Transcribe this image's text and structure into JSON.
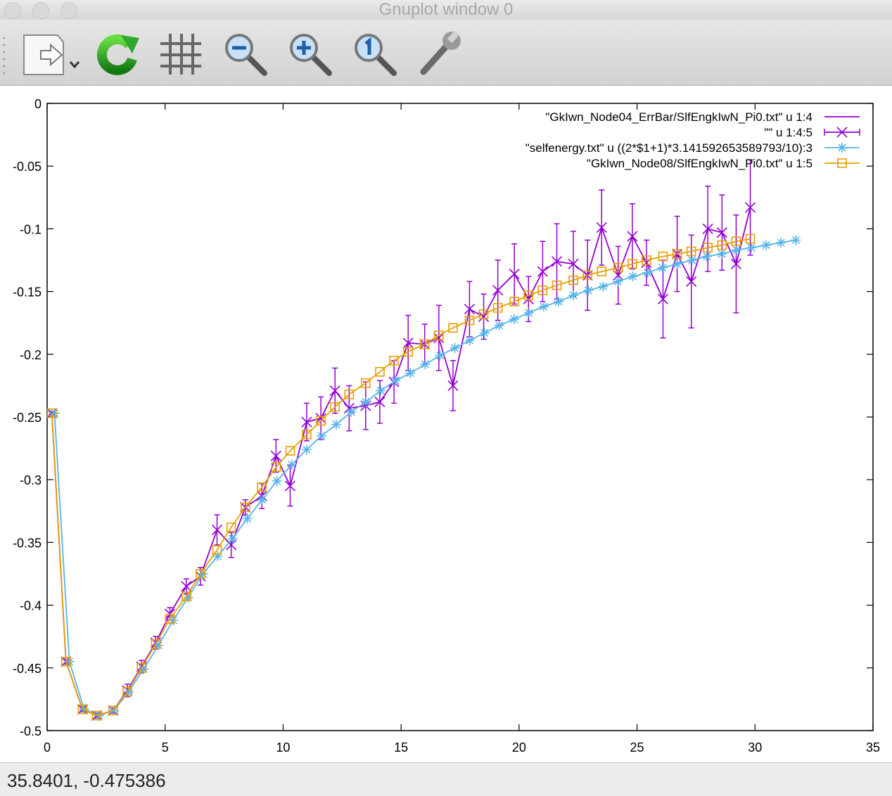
{
  "window": {
    "title": "Gnuplot window 0"
  },
  "toolbar": {
    "buttons": [
      {
        "name": "export-button",
        "icon": "export-document-icon"
      },
      {
        "name": "replot-button",
        "icon": "replot-icon"
      },
      {
        "name": "grid-button",
        "icon": "grid-icon"
      },
      {
        "name": "zoom-prev-button",
        "icon": "zoom-out-icon"
      },
      {
        "name": "zoom-next-button",
        "icon": "zoom-in-icon"
      },
      {
        "name": "unzoom-button",
        "icon": "zoom-reset-icon"
      },
      {
        "name": "settings-button",
        "icon": "wrench-icon"
      }
    ]
  },
  "status": {
    "coords": "35.8401, -0.475386"
  },
  "chart_data": {
    "type": "line",
    "xlim": [
      0,
      35
    ],
    "ylim": [
      -0.5,
      0
    ],
    "grid": false,
    "legend_position": "top-right",
    "xticks": [
      "0",
      "5",
      "10",
      "15",
      "20",
      "25",
      "30",
      "35"
    ],
    "yticks": [
      "0",
      "-0.05",
      "-0.1",
      "-0.15",
      "-0.2",
      "-0.25",
      "-0.3",
      "-0.35",
      "-0.4",
      "-0.45",
      "-0.5"
    ],
    "xtick_values": [
      0,
      5,
      10,
      15,
      20,
      25,
      30,
      35
    ],
    "ytick_values": [
      0,
      -0.05,
      -0.1,
      -0.15,
      -0.2,
      -0.25,
      -0.3,
      -0.35,
      -0.4,
      -0.45,
      -0.5
    ],
    "series": [
      {
        "name": "\"GkIwn_Node04_ErrBar/SlfEngkIwN_Pi0.txt\" u 1:4",
        "style": "line",
        "color": "#9400d3",
        "x": [
          0.2,
          0.8,
          1.5,
          2.1,
          2.8,
          3.4,
          4.0,
          4.6,
          5.2,
          5.9,
          6.5,
          7.2,
          7.8,
          8.4,
          9.1,
          9.7,
          10.3,
          11.0,
          11.6,
          12.2,
          12.8,
          13.5,
          14.1,
          14.7,
          15.3,
          16.0,
          16.6,
          17.2,
          17.9,
          18.5,
          19.1,
          19.8,
          20.4,
          21.0,
          21.6,
          22.3,
          22.9,
          23.5,
          24.2,
          24.8,
          25.4,
          26.1,
          26.7,
          27.3,
          28.0,
          28.6,
          29.2,
          29.8
        ],
        "y": [
          -0.247,
          -0.445,
          -0.483,
          -0.488,
          -0.484,
          -0.468,
          -0.449,
          -0.43,
          -0.407,
          -0.385,
          -0.377,
          -0.34,
          -0.352,
          -0.322,
          -0.313,
          -0.281,
          -0.305,
          -0.254,
          -0.251,
          -0.229,
          -0.243,
          -0.241,
          -0.238,
          -0.222,
          -0.191,
          -0.192,
          -0.187,
          -0.225,
          -0.164,
          -0.17,
          -0.149,
          -0.136,
          -0.156,
          -0.134,
          -0.126,
          -0.128,
          -0.137,
          -0.099,
          -0.137,
          -0.106,
          -0.127,
          -0.156,
          -0.12,
          -0.142,
          -0.1,
          -0.103,
          -0.128,
          -0.083
        ]
      },
      {
        "name": "\"\" u 1:4:5",
        "style": "errorbars",
        "color": "#9400d3",
        "x": [
          0.2,
          0.8,
          1.5,
          2.1,
          2.8,
          3.4,
          4.0,
          4.6,
          5.2,
          5.9,
          6.5,
          7.2,
          7.8,
          8.4,
          9.1,
          9.7,
          10.3,
          11.0,
          11.6,
          12.2,
          12.8,
          13.5,
          14.1,
          14.7,
          15.3,
          16.0,
          16.6,
          17.2,
          17.9,
          18.5,
          19.1,
          19.8,
          20.4,
          21.0,
          21.6,
          22.3,
          22.9,
          23.5,
          24.2,
          24.8,
          25.4,
          26.1,
          26.7,
          27.3,
          28.0,
          28.6,
          29.2,
          29.8
        ],
        "y": [
          -0.247,
          -0.445,
          -0.483,
          -0.488,
          -0.484,
          -0.468,
          -0.449,
          -0.43,
          -0.407,
          -0.385,
          -0.377,
          -0.34,
          -0.352,
          -0.322,
          -0.313,
          -0.281,
          -0.305,
          -0.254,
          -0.251,
          -0.229,
          -0.243,
          -0.241,
          -0.238,
          -0.222,
          -0.191,
          -0.192,
          -0.187,
          -0.225,
          -0.164,
          -0.17,
          -0.149,
          -0.136,
          -0.156,
          -0.134,
          -0.126,
          -0.128,
          -0.137,
          -0.099,
          -0.137,
          -0.106,
          -0.127,
          -0.156,
          -0.12,
          -0.142,
          -0.1,
          -0.103,
          -0.128,
          -0.083
        ],
        "err": [
          0.001,
          0.002,
          0.002,
          0.002,
          0.002,
          0.005,
          0.005,
          0.005,
          0.005,
          0.006,
          0.007,
          0.012,
          0.01,
          0.006,
          0.01,
          0.013,
          0.016,
          0.015,
          0.017,
          0.018,
          0.018,
          0.019,
          0.017,
          0.017,
          0.022,
          0.016,
          0.026,
          0.02,
          0.022,
          0.018,
          0.024,
          0.024,
          0.018,
          0.024,
          0.03,
          0.026,
          0.028,
          0.03,
          0.023,
          0.026,
          0.018,
          0.031,
          0.03,
          0.037,
          0.034,
          0.03,
          0.039,
          0.038
        ]
      },
      {
        "name": "\"selfenergy.txt\" u ((2*$1+1)*3.141592653589793/10):3",
        "style": "linespoints-star",
        "color": "#56b4e9",
        "x": [
          0.314,
          0.942,
          1.571,
          2.199,
          2.827,
          3.456,
          4.084,
          4.712,
          5.341,
          5.969,
          6.597,
          7.226,
          7.854,
          8.482,
          9.111,
          9.739,
          10.367,
          10.996,
          11.624,
          12.252,
          12.881,
          13.509,
          14.137,
          14.765,
          15.394,
          16.022,
          16.65,
          17.279,
          17.907,
          18.535,
          19.164,
          19.792,
          20.42,
          21.049,
          21.677,
          22.305,
          22.934,
          23.562,
          24.19,
          24.819,
          25.447,
          26.075,
          26.704,
          27.332,
          27.96,
          28.588,
          29.217,
          29.845,
          30.473,
          31.102,
          31.73
        ],
        "y": [
          -0.247,
          -0.445,
          -0.483,
          -0.488,
          -0.484,
          -0.469,
          -0.451,
          -0.432,
          -0.412,
          -0.394,
          -0.375,
          -0.361,
          -0.347,
          -0.331,
          -0.316,
          -0.301,
          -0.288,
          -0.276,
          -0.265,
          -0.256,
          -0.246,
          -0.238,
          -0.229,
          -0.221,
          -0.215,
          -0.208,
          -0.201,
          -0.195,
          -0.189,
          -0.183,
          -0.177,
          -0.172,
          -0.167,
          -0.162,
          -0.158,
          -0.153,
          -0.149,
          -0.146,
          -0.142,
          -0.138,
          -0.135,
          -0.131,
          -0.128,
          -0.125,
          -0.122,
          -0.12,
          -0.117,
          -0.115,
          -0.113,
          -0.111,
          -0.109
        ]
      },
      {
        "name": "\"GkIwn_Node08/SlfEngkIwN_Pi0.txt\" u 1:5",
        "style": "linespoints-square",
        "color": "#e69f00",
        "x": [
          0.2,
          0.8,
          1.5,
          2.1,
          2.8,
          3.4,
          4.0,
          4.6,
          5.2,
          5.9,
          6.5,
          7.2,
          7.8,
          8.4,
          9.1,
          9.7,
          10.3,
          11.0,
          11.6,
          12.2,
          12.8,
          13.5,
          14.1,
          14.7,
          15.3,
          16.0,
          16.6,
          17.2,
          17.9,
          18.5,
          19.1,
          19.8,
          20.4,
          21.0,
          21.6,
          22.3,
          22.9,
          23.5,
          24.2,
          24.8,
          25.4,
          26.1,
          26.7,
          27.3,
          28.0,
          28.6,
          29.2,
          29.8
        ],
        "y": [
          -0.247,
          -0.445,
          -0.483,
          -0.488,
          -0.484,
          -0.469,
          -0.45,
          -0.431,
          -0.411,
          -0.393,
          -0.375,
          -0.356,
          -0.338,
          -0.322,
          -0.306,
          -0.29,
          -0.277,
          -0.264,
          -0.253,
          -0.242,
          -0.232,
          -0.223,
          -0.214,
          -0.205,
          -0.198,
          -0.192,
          -0.185,
          -0.179,
          -0.173,
          -0.168,
          -0.163,
          -0.158,
          -0.153,
          -0.149,
          -0.145,
          -0.141,
          -0.137,
          -0.134,
          -0.131,
          -0.128,
          -0.125,
          -0.122,
          -0.12,
          -0.118,
          -0.115,
          -0.113,
          -0.11,
          -0.108
        ]
      }
    ]
  }
}
